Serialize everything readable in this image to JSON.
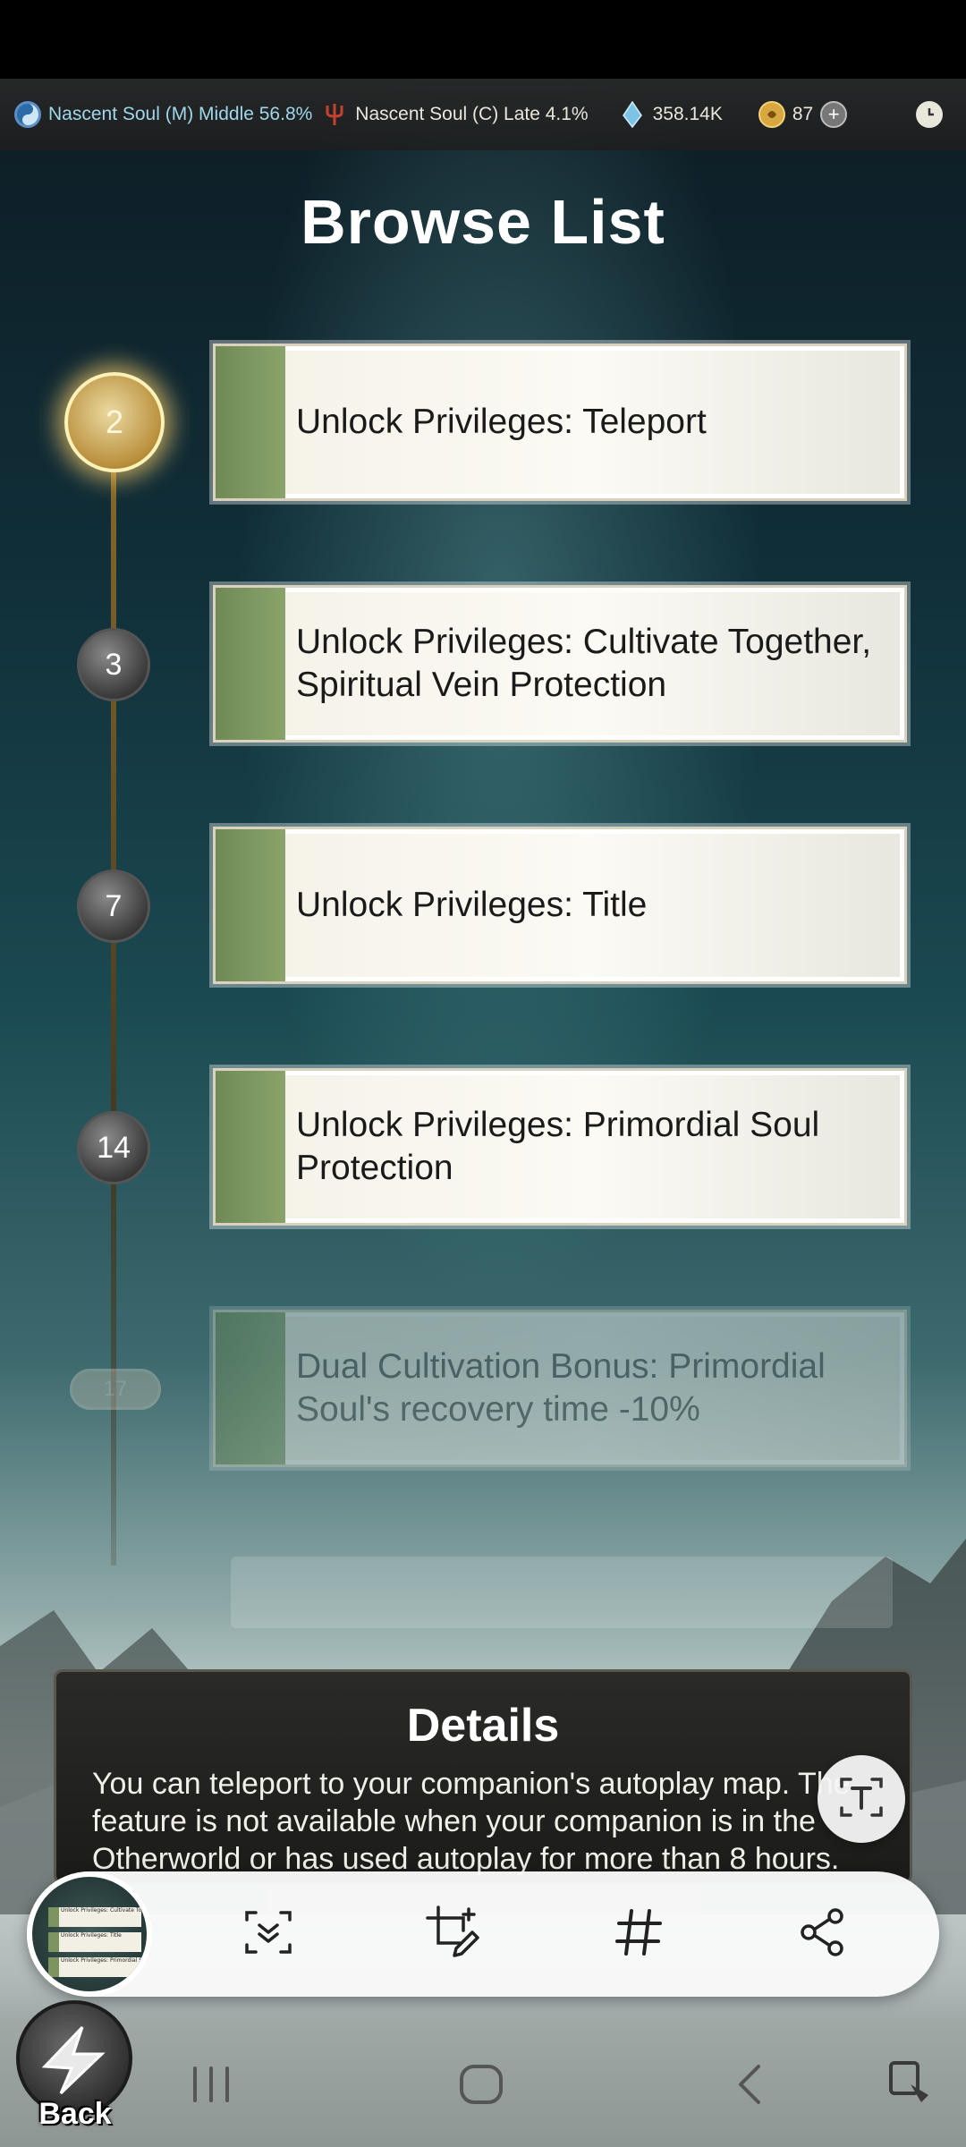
{
  "status_bar": {
    "realm_1": "Nascent Soul (M) Middle 56.8%",
    "realm_2": "Nascent Soul (C) Late 4.1%",
    "spirit_stones": "358.14K",
    "currency": "87"
  },
  "page": {
    "title": "Browse List"
  },
  "milestones": [
    {
      "level": "2",
      "text": "Unlock Privileges: Teleport"
    },
    {
      "level": "3",
      "text": "Unlock Privileges: Cultivate Together, Spiritual Vein Protection"
    },
    {
      "level": "7",
      "text": "Unlock Privileges: Title"
    },
    {
      "level": "14",
      "text": "Unlock Privileges: Primordial Soul Protection"
    },
    {
      "level": "17",
      "text": "Dual Cultivation Bonus: Primordial Soul's recovery time -10%"
    }
  ],
  "details": {
    "title": "Details",
    "body": "You can teleport to your companion's autoplay map. The feature is not available when your companion is in the Otherworld or has used autoplay for more than 8 hours."
  },
  "thumbnail": {
    "line_1": "Unlock Privileges: Cultivate Together, Spiritual Vein Protection",
    "line_2": "Unlock Privileges: Title",
    "line_3": "Unlock Privileges: Primordial Soul Protection"
  },
  "buttons": {
    "back_label": "Back"
  },
  "icons": {
    "realm_1": "yin-yang-icon",
    "realm_2": "trident-icon",
    "spirit_stones": "crystal-icon",
    "currency": "coin-icon",
    "add": "plus-icon",
    "clock": "clock-icon"
  },
  "colors": {
    "accent_gold": "#c9a24a",
    "card_strip": "#7d9460",
    "text_dark": "#1a1a1a"
  }
}
